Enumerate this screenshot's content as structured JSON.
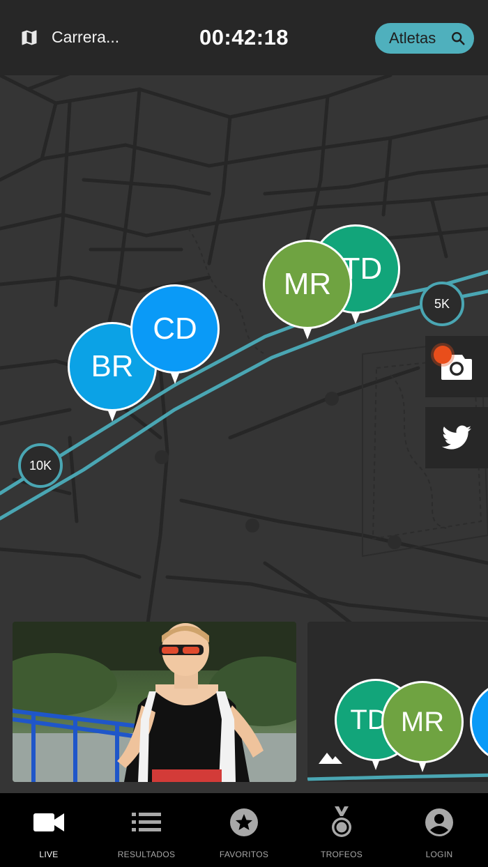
{
  "header": {
    "race_name": "Carrera...",
    "timer": "00:42:18",
    "athletes_label": "Atletas"
  },
  "map": {
    "markers": {
      "km_5": "5K",
      "km_10": "10K"
    },
    "athletes": [
      {
        "initials": "TD",
        "color": "#12a57a"
      },
      {
        "initials": "MR",
        "color": "#6fa341"
      },
      {
        "initials": "CD",
        "color": "#0a9af7"
      },
      {
        "initials": "BR",
        "color": "#0ba2e6"
      }
    ],
    "route_color": "#4aa6b3"
  },
  "cards": {
    "mini_athletes": [
      {
        "initials": "TD",
        "color": "#12a57a"
      },
      {
        "initials": "MR",
        "color": "#6fa341"
      },
      {
        "initials": "",
        "color": "#0a9af7"
      }
    ]
  },
  "nav": {
    "items": [
      {
        "label": "LIVE",
        "icon": "video-camera-icon"
      },
      {
        "label": "RESULTADOS",
        "icon": "list-icon"
      },
      {
        "label": "FAVORITOS",
        "icon": "star-icon"
      },
      {
        "label": "TROFEOS",
        "icon": "medal-icon"
      },
      {
        "label": "LOGIN",
        "icon": "user-icon"
      }
    ]
  }
}
